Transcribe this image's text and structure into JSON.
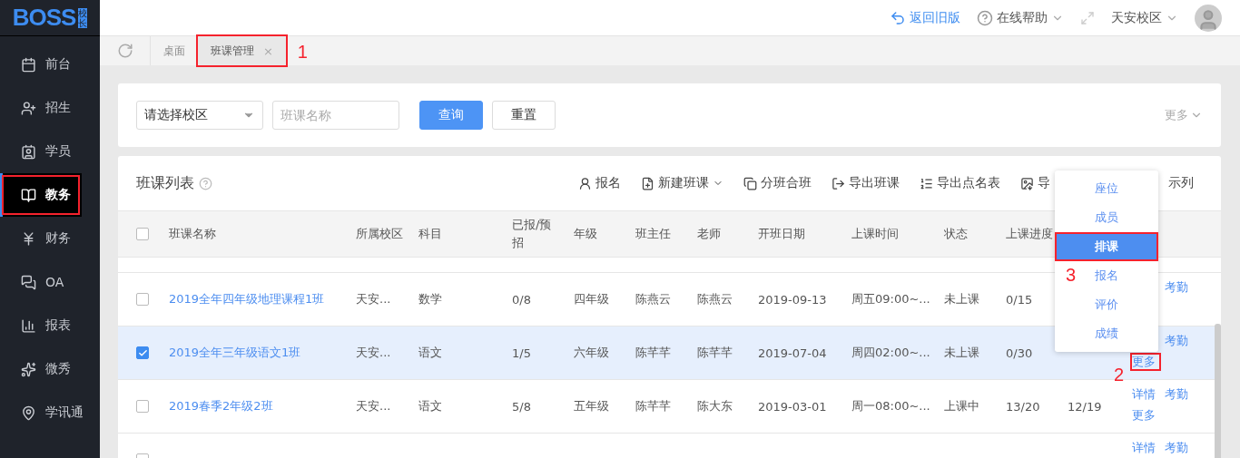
{
  "logo": {
    "text": "BOSS",
    "badge": "校长"
  },
  "sidebar": {
    "items": [
      {
        "label": "前台",
        "selected": false,
        "outlined": false
      },
      {
        "label": "招生",
        "selected": false,
        "outlined": false
      },
      {
        "label": "学员",
        "selected": false,
        "outlined": false
      },
      {
        "label": "教务",
        "selected": true,
        "outlined": true
      },
      {
        "label": "财务",
        "selected": false,
        "outlined": false
      },
      {
        "label": "OA",
        "selected": false,
        "outlined": false
      },
      {
        "label": "报表",
        "selected": false,
        "outlined": false
      },
      {
        "label": "微秀",
        "selected": false,
        "outlined": false
      },
      {
        "label": "学讯通",
        "selected": false,
        "outlined": false
      }
    ]
  },
  "header": {
    "back_link": "返回旧版",
    "help": "在线帮助",
    "campus": "天安校区"
  },
  "tabs": [
    {
      "label": "桌面",
      "selected": false,
      "closable": false
    },
    {
      "label": "班课管理",
      "selected": true,
      "closable": true,
      "close": "×",
      "callout": "1"
    }
  ],
  "filter": {
    "campus_select": "请选择校区",
    "name_placeholder": "班课名称",
    "search_button": "查询",
    "reset_button": "重置",
    "more": "更多"
  },
  "list": {
    "title": "班课列表",
    "all_selected": false,
    "toolbar": [
      "报名",
      "新建班课",
      "分班合班",
      "导出班课",
      "导出点名表",
      "导",
      "示列"
    ],
    "columns": [
      "班课名称",
      "所属校区",
      "科目",
      "已报/预招",
      "年级",
      "班主任",
      "老师",
      "开班日期",
      "上课时间",
      "状态",
      "上课进度"
    ],
    "rows": [
      {
        "selected": false,
        "cells": [
          "2019全年四年级地理课程1班",
          "天安...",
          "数学",
          "0/8",
          "四年级",
          "陈燕云",
          "陈燕云",
          "2019-09-13",
          "周五09:00~...",
          "未上课",
          "0/15",
          ""
        ],
        "actions": [
          "考勤"
        ]
      },
      {
        "selected": true,
        "cells": [
          "2019全年三年级语文1班",
          "天安...",
          "语文",
          "1/5",
          "六年级",
          "陈芊芊",
          "陈芊芊",
          "2019-07-04",
          "周四02:00~...",
          "未上课",
          "0/30",
          ""
        ],
        "actions": [
          "考勤"
        ],
        "more": "更多",
        "callout": "2"
      },
      {
        "selected": false,
        "cells": [
          "2019春季2年级2班",
          "天安...",
          "语文",
          "5/8",
          "五年级",
          "陈芊芊",
          "陈大东",
          "2019-03-01",
          "周一08:00~...",
          "上课中",
          "13/20",
          "12/19"
        ],
        "actions": [
          "详情",
          "考勤"
        ],
        "more": "更多"
      },
      {
        "selected": false,
        "cells": [
          "",
          "",
          "",
          "",
          "",
          "",
          "",
          "",
          "",
          "",
          "",
          ""
        ],
        "actions": [
          "详情",
          "考勤"
        ]
      }
    ],
    "menu": [
      {
        "label": "座位",
        "selected": false
      },
      {
        "label": "成员",
        "selected": false
      },
      {
        "label": "排课",
        "selected": true
      },
      {
        "label": "报名",
        "selected": false,
        "callout": "3"
      },
      {
        "label": "评价",
        "selected": false
      },
      {
        "label": "成绩",
        "selected": false
      }
    ]
  }
}
